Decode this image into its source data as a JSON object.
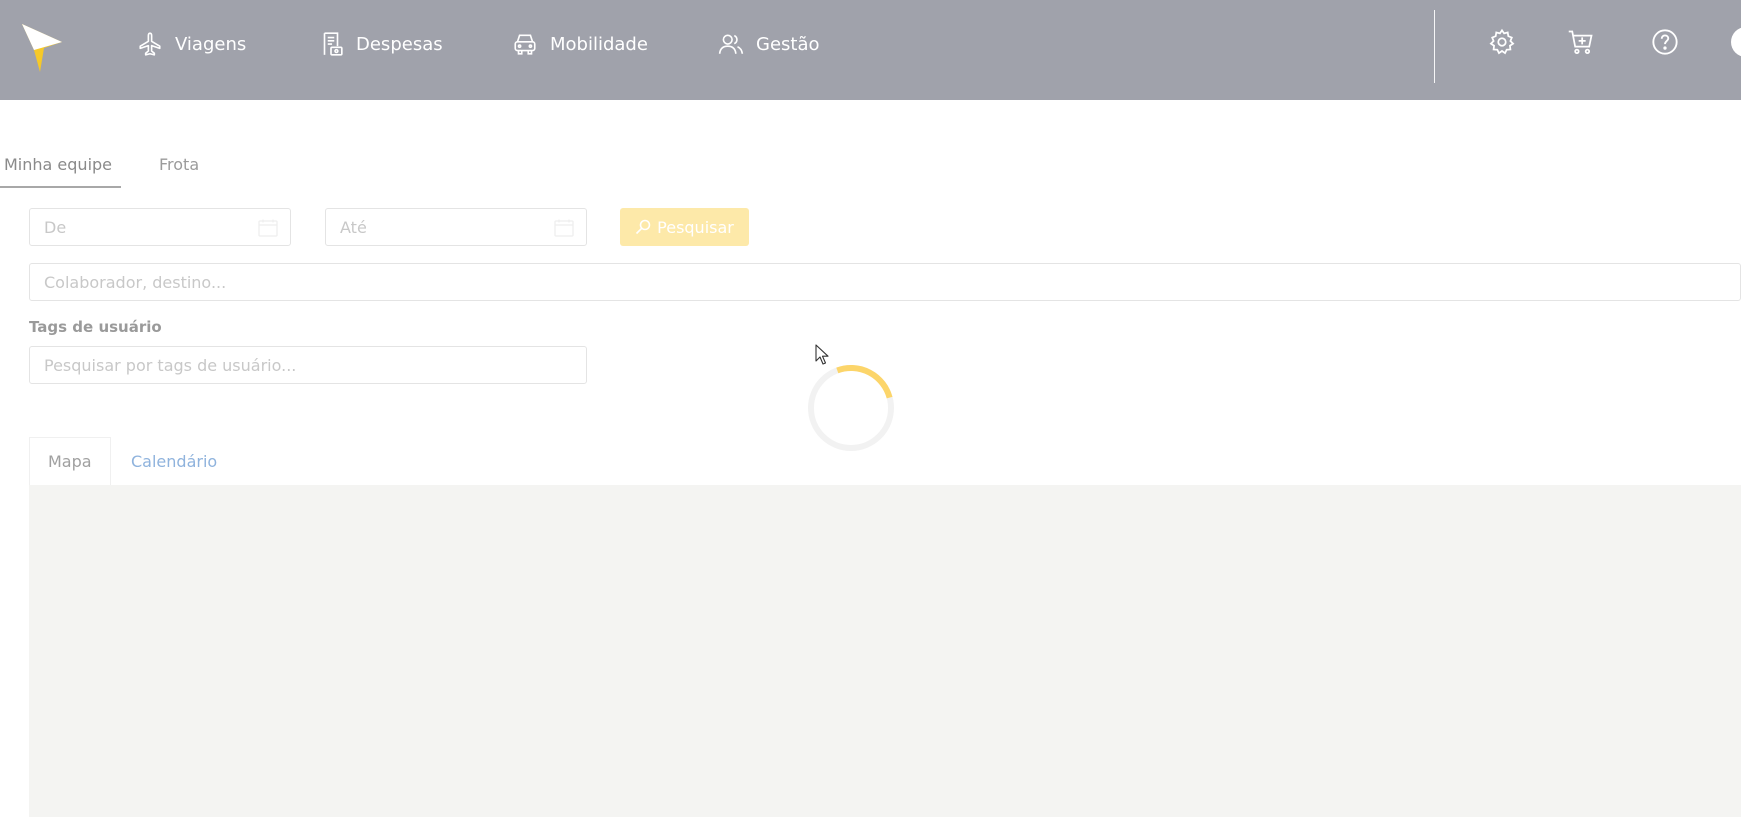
{
  "nav": {
    "items": [
      {
        "label": "Viagens",
        "icon": "airplane-icon"
      },
      {
        "label": "Despesas",
        "icon": "receipt-icon"
      },
      {
        "label": "Mobilidade",
        "icon": "car-icon"
      },
      {
        "label": "Gestão",
        "icon": "users-icon"
      }
    ],
    "right_icons": [
      "gear-icon",
      "cart-add-icon",
      "help-icon"
    ]
  },
  "tabs": {
    "items": [
      {
        "label": "Minha equipe",
        "active": true
      },
      {
        "label": "Frota",
        "active": false
      }
    ]
  },
  "filters": {
    "from_placeholder": "De",
    "to_placeholder": "Até",
    "search_button": "Pesquisar",
    "query_placeholder": "Colaborador, destino...",
    "tags_label": "Tags de usuário",
    "tags_placeholder": "Pesquisar por tags de usuário..."
  },
  "view_tabs": {
    "items": [
      {
        "label": "Mapa",
        "active": true
      },
      {
        "label": "Calendário",
        "active": false
      }
    ]
  },
  "colors": {
    "topbar": "#a0a2ab",
    "accent": "#fcd56a",
    "link": "#8fb3dd",
    "map_bg": "#f4f4f2"
  }
}
